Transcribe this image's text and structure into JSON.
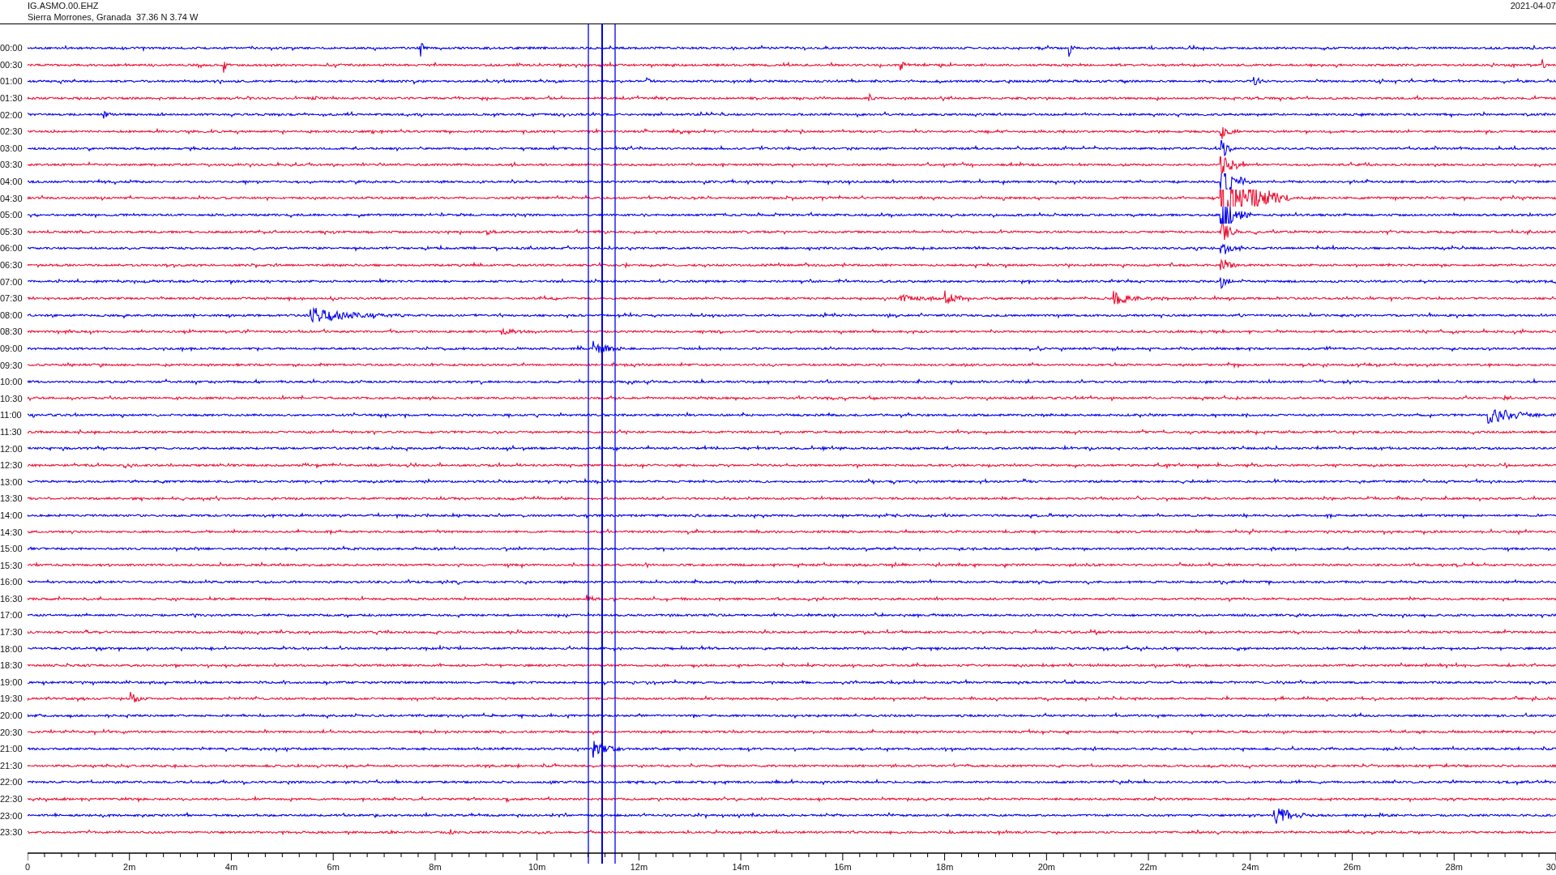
{
  "header": {
    "station": "IG.ASMO.00.EHZ",
    "location": "Sierra Morrones, Granada  37.36 N 3.74 W",
    "date": "2021-04-07"
  },
  "rows": [
    {
      "time": "00:00",
      "color": "#0000ee"
    },
    {
      "time": "00:30",
      "color": "#ee1133"
    },
    {
      "time": "01:00",
      "color": "#0000ee"
    },
    {
      "time": "01:30",
      "color": "#ee1133"
    },
    {
      "time": "02:00",
      "color": "#0000ee"
    },
    {
      "time": "02:30",
      "color": "#ee1133"
    },
    {
      "time": "03:00",
      "color": "#0000ee"
    },
    {
      "time": "03:30",
      "color": "#ee1133"
    },
    {
      "time": "04:00",
      "color": "#0000ee"
    },
    {
      "time": "04:30",
      "color": "#ee1133"
    },
    {
      "time": "05:00",
      "color": "#0000ee"
    },
    {
      "time": "05:30",
      "color": "#ee1133"
    },
    {
      "time": "06:00",
      "color": "#0000ee"
    },
    {
      "time": "06:30",
      "color": "#ee1133"
    },
    {
      "time": "07:00",
      "color": "#0000ee"
    },
    {
      "time": "07:30",
      "color": "#ee1133"
    },
    {
      "time": "08:00",
      "color": "#0000ee"
    },
    {
      "time": "08:30",
      "color": "#ee1133"
    },
    {
      "time": "09:00",
      "color": "#0000ee"
    },
    {
      "time": "09:30",
      "color": "#ee1133"
    },
    {
      "time": "10:00",
      "color": "#0000ee"
    },
    {
      "time": "10:30",
      "color": "#ee1133"
    },
    {
      "time": "11:00",
      "color": "#0000ee"
    },
    {
      "time": "11:30",
      "color": "#ee1133"
    },
    {
      "time": "12:00",
      "color": "#0000ee"
    },
    {
      "time": "12:30",
      "color": "#ee1133"
    },
    {
      "time": "13:00",
      "color": "#0000ee"
    },
    {
      "time": "13:30",
      "color": "#ee1133"
    },
    {
      "time": "14:00",
      "color": "#0000ee"
    },
    {
      "time": "14:30",
      "color": "#ee1133"
    },
    {
      "time": "15:00",
      "color": "#0000ee"
    },
    {
      "time": "15:30",
      "color": "#ee1133"
    },
    {
      "time": "16:00",
      "color": "#0000ee"
    },
    {
      "time": "16:30",
      "color": "#ee1133"
    },
    {
      "time": "17:00",
      "color": "#0000ee"
    },
    {
      "time": "17:30",
      "color": "#ee1133"
    },
    {
      "time": "18:00",
      "color": "#0000ee"
    },
    {
      "time": "18:30",
      "color": "#ee1133"
    },
    {
      "time": "19:00",
      "color": "#0000ee"
    },
    {
      "time": "19:30",
      "color": "#ee1133"
    },
    {
      "time": "20:00",
      "color": "#0000ee"
    },
    {
      "time": "20:30",
      "color": "#ee1133"
    },
    {
      "time": "21:00",
      "color": "#0000ee"
    },
    {
      "time": "21:30",
      "color": "#ee1133"
    },
    {
      "time": "22:00",
      "color": "#0000ee"
    },
    {
      "time": "22:30",
      "color": "#ee1133"
    },
    {
      "time": "23:00",
      "color": "#0000ee"
    },
    {
      "time": "23:30",
      "color": "#ee1133"
    }
  ],
  "axis": {
    "ticks": [
      "0",
      "2m",
      "4m",
      "6m",
      "8m",
      "10m",
      "12m",
      "14m",
      "16m",
      "18m",
      "20m",
      "22m",
      "24m",
      "26m",
      "28m",
      "30"
    ]
  }
}
